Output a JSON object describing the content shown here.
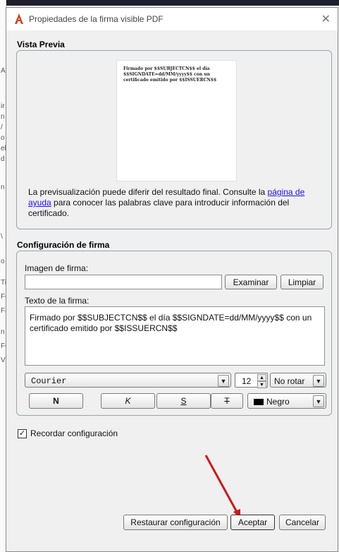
{
  "dialog": {
    "title": "Propiedades de la firma visible PDF",
    "close_label": "✕"
  },
  "background": {
    "glyphs": [
      "A",
      "ir",
      "n",
      "/",
      "o",
      "el",
      "d",
      "n",
      "\\",
      "o",
      "Ti",
      "Fe",
      "Fa",
      "n",
      "Fc",
      "V"
    ]
  },
  "preview": {
    "section_label": "Vista Previa",
    "text": "Firmado por $$SUBJECTCN$$ el día $$SIGNDATE=dd/MM/yyyy$$ con un certificado emitido por $$ISSUERCN$$",
    "info_prefix": "La previsualización puede diferir del resultado final. Consulte la ",
    "info_link": "página de ayuda",
    "info_suffix": " para conocer las palabras clave para introducir información del certificado."
  },
  "config": {
    "section_label": "Configuración de firma",
    "image_label": "Imagen de firma:",
    "image_value": "",
    "browse_label": "Examinar",
    "clear_label": "Limpiar",
    "text_label": "Texto de la firma:",
    "text_value": "Firmado por $$SUBJECTCN$$ el día $$SIGNDATE=dd/MM/yyyy$$ con un certificado emitido por $$ISSUERCN$$",
    "font_value": "Courier",
    "size_value": "12",
    "rotation_value": "No rotar",
    "bold_label": "N",
    "italic_label": "K",
    "underline_label": "S",
    "strike_label": "T",
    "color_value": "Negro"
  },
  "remember": {
    "label": "Recordar configuración",
    "checked": true
  },
  "footer": {
    "restore_label": "Restaurar configuración",
    "accept_label": "Aceptar",
    "cancel_label": "Cancelar"
  },
  "colors": {
    "link": "#1a0dff",
    "annotation_arrow": "#cc1a1a",
    "app_icon": "#d0421b"
  }
}
